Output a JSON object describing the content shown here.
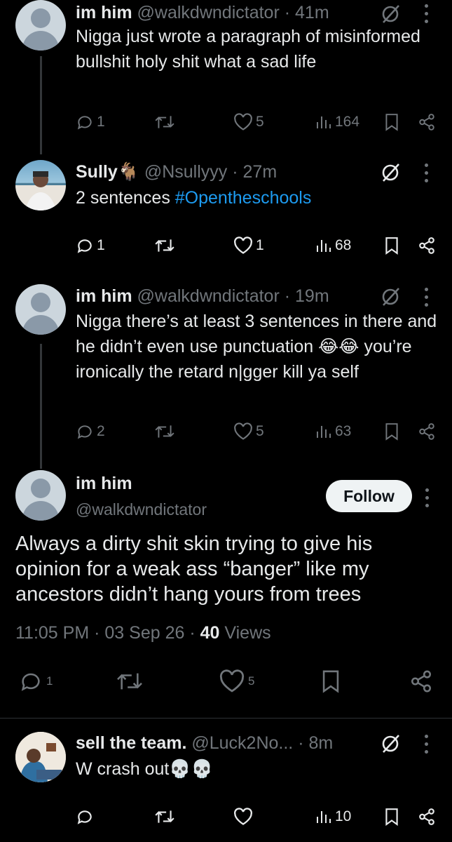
{
  "tweets": [
    {
      "name": "im him",
      "handle": "@walkdwndictator",
      "time": "41m",
      "text": "Nigga just wrote a paragraph of misinformed bullshit holy shit what a sad life",
      "replies": "1",
      "retweets": "",
      "likes": "5",
      "views": "164"
    },
    {
      "name": "Sully",
      "name_emoji": "🐐",
      "handle": "@Nsullyyy",
      "time": "27m",
      "text": "2 sentences ",
      "hashtag": "#Opentheschools",
      "replies": "1",
      "retweets": "",
      "likes": "1",
      "views": "68"
    },
    {
      "name": "im him",
      "handle": "@walkdwndictator",
      "time": "19m",
      "text": "Nigga there’s at least 3 sentences in there and he didn’t even use punctuation 😂😂 you’re ironically the retard n|gger kill ya self",
      "replies": "2",
      "retweets": "",
      "likes": "5",
      "views": "63"
    }
  ],
  "main_tweet": {
    "name": "im him",
    "handle": "@walkdwndictator",
    "follow_label": "Follow",
    "text": "Always a dirty shit skin trying to give his opinion for a weak ass “banger” like my ancestors didn’t hang yours from trees",
    "time": "11:05 PM",
    "date": "03 Sep 26",
    "views_count": "40",
    "views_label": "Views",
    "replies": "1",
    "likes": "5"
  },
  "reply": {
    "name": "sell the team.",
    "handle": "@Luck2No...",
    "time": "8m",
    "text": "W crash out💀💀",
    "replies": "",
    "likes": "",
    "views": "10"
  },
  "separator": "·",
  "colors": {
    "background": "#000000",
    "text": "#e7e9ea",
    "muted": "#71767b",
    "link": "#1d9bf0",
    "follow_bg": "#eff3f4"
  }
}
